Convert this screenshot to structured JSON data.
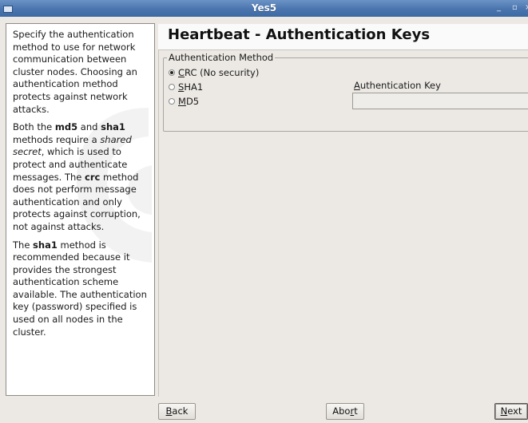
{
  "window": {
    "title": "Yes5",
    "minimize_glyph": "_",
    "maximize_glyph": "▫",
    "close_glyph": "×"
  },
  "help": {
    "p1": "Specify the authentication method to use for network communication between cluster nodes. Choosing an authentication method protects against network attacks.",
    "p2": {
      "t1": "Both the ",
      "b1": "md5",
      "t2": " and ",
      "b2": "sha1",
      "t3": " methods require a ",
      "i1": "shared secret",
      "t4": ", which is used to protect and authenticate messages. The ",
      "b3": "crc",
      "t5": " method does not perform message authentication and only protects against corruption, not against attacks."
    },
    "p3": {
      "t1": "The ",
      "b1": "sha1",
      "t2": " method is recommended because it provides the strongest authentication scheme available. The authentication key (password) specified is used on all nodes in the cluster."
    }
  },
  "page": {
    "title": "Heartbeat - Authentication Keys"
  },
  "auth": {
    "group_label": "Authentication Method",
    "options": [
      {
        "mnemonic": "C",
        "rest": "RC (No security)",
        "selected": true
      },
      {
        "mnemonic": "S",
        "rest": "HA1",
        "selected": false
      },
      {
        "mnemonic": "M",
        "rest": "D5",
        "selected": false
      }
    ],
    "key_label": {
      "mnemonic": "A",
      "rest": "uthentication Key"
    },
    "key_value": ""
  },
  "buttons": {
    "back": {
      "mnemonic": "B",
      "rest": "ack"
    },
    "abort": {
      "pre": "Abo",
      "mnemonic": "r",
      "rest": "t"
    },
    "next": {
      "mnemonic": "N",
      "rest": "ext"
    }
  }
}
